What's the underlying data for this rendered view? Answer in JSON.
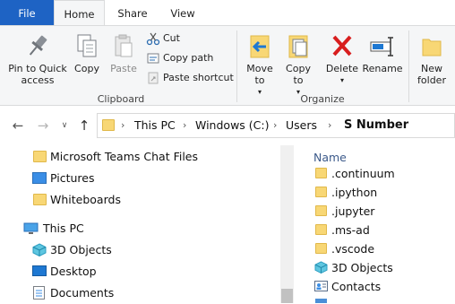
{
  "ribbon_tabs": {
    "file": "File",
    "home": "Home",
    "share": "Share",
    "view": "View"
  },
  "clipboard": {
    "pin_label": "Pin to Quick access",
    "pin_line1": "Pin to Quick",
    "pin_line2": "access",
    "copy_label": "Copy",
    "paste_label": "Paste",
    "cut_label": "Cut",
    "copy_path_label": "Copy path",
    "paste_shortcut_label": "Paste shortcut",
    "group_label": "Clipboard"
  },
  "organize": {
    "move_to_label": "Move to",
    "copy_to_label": "Copy to",
    "delete_label": "Delete",
    "rename_label": "Rename",
    "group_label": "Organize"
  },
  "new_group": {
    "new_folder_line1": "New",
    "new_folder_line2": "folder"
  },
  "address": {
    "breadcrumbs": [
      "This PC",
      "Windows (C:)",
      "Users",
      "S Number"
    ]
  },
  "nav_pane": {
    "items": [
      {
        "label": "Microsoft Teams Chat Files",
        "icon": "folder-icon"
      },
      {
        "label": "Pictures",
        "icon": "pictures-icon"
      },
      {
        "label": "Whiteboards",
        "icon": "folder-icon"
      },
      {
        "label": "This PC",
        "icon": "computer-icon"
      },
      {
        "label": "3D Objects",
        "icon": "3d-objects-icon"
      },
      {
        "label": "Desktop",
        "icon": "desktop-icon"
      },
      {
        "label": "Documents",
        "icon": "documents-icon"
      }
    ]
  },
  "content": {
    "column_name": "Name",
    "files": [
      {
        "name": ".continuum",
        "icon": "folder-icon"
      },
      {
        "name": ".ipython",
        "icon": "folder-icon"
      },
      {
        "name": ".jupyter",
        "icon": "folder-icon"
      },
      {
        "name": ".ms-ad",
        "icon": "folder-icon"
      },
      {
        "name": ".vscode",
        "icon": "folder-icon"
      },
      {
        "name": "3D Objects",
        "icon": "3d-objects-icon"
      },
      {
        "name": "Contacts",
        "icon": "contacts-icon"
      }
    ]
  },
  "colors": {
    "file_tab": "#1e63c4",
    "accent": "#0078d7",
    "folder": "#f8d775"
  }
}
